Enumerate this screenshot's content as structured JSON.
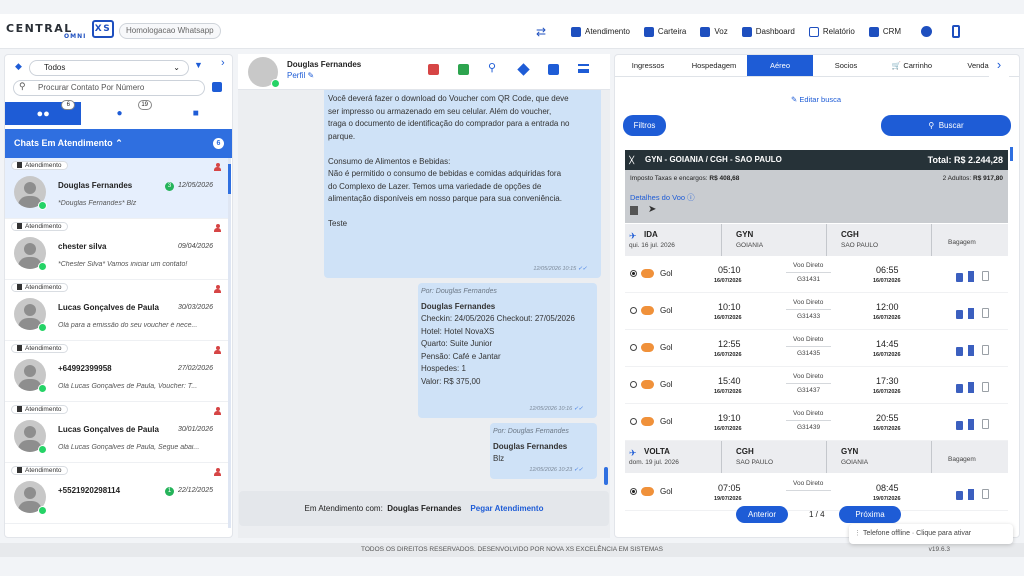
{
  "app": {
    "logo": "CENTRAL",
    "logo_sub": "OMNI",
    "logo_mark": "XS",
    "env": "Homologacao Whatsapp",
    "version": "v19.6.3",
    "footer": "TODOS OS DIREITOS RESERVADOS.  DESENVOLVIDO POR  NOVA XS EXCELÊNCIA EM SISTEMAS"
  },
  "topnav": {
    "items": [
      "Atendimento",
      "Carteira",
      "Voz",
      "Dashboard",
      "Relatório",
      "CRM"
    ]
  },
  "left": {
    "filter_value": "Todos",
    "search_placeholder": "Procurar Contato Por Número",
    "tab_badges": [
      "6",
      "19"
    ],
    "section_title": "Chats Em Atendimento",
    "section_count": "6",
    "chats": [
      {
        "tag": "Atendimento",
        "name": "Douglas Fernandes",
        "date": "12/05/2026",
        "msg": "*Douglas Fernandes* Blz",
        "unread": "3"
      },
      {
        "tag": "Atendimento",
        "name": "chester silva",
        "date": "09/04/2026",
        "msg": "*Chester Silva* Vamos iniciar um contato!",
        "unread": ""
      },
      {
        "tag": "Atendimento",
        "name": "Lucas Gonçalves de Paula",
        "date": "30/03/2026",
        "msg": "Olá para a emissão do seu voucher é nece...",
        "unread": ""
      },
      {
        "tag": "Atendimento",
        "name": "+64992399958",
        "date": "27/02/2026",
        "msg": "Olá Lucas Gonçalves de Paula, Voucher: T...",
        "unread": ""
      },
      {
        "tag": "Atendimento",
        "name": "Lucas Gonçalves de Paula",
        "date": "30/01/2026",
        "msg": "Olá Lucas Gonçalves de Paula, Segue abai...",
        "unread": ""
      },
      {
        "tag": "Atendimento",
        "name": "+5521920298114",
        "date": "22/12/2025",
        "msg": "",
        "unread": "1"
      }
    ]
  },
  "mid": {
    "contact_name": "Douglas Fernandes",
    "perfil": "Perfil",
    "msg1": {
      "lines": [
        "Você deverá fazer o download do Voucher com QR Code, que deve",
        "ser impresso ou armazenado em seu celular. Além do voucher,",
        "traga o documento de identificação do comprador para a entrada no",
        "parque.",
        "",
        "Consumo de Alimentos e Bebidas:",
        "Não é permitido o consumo de bebidas e comidas adquiridas fora",
        "do Complexo de Lazer. Temos uma variedade de opções de",
        "alimentação disponíveis em nosso parque para sua conveniência.",
        "",
        "Teste"
      ],
      "time": "12/05/2026 10:15"
    },
    "msg2": {
      "by": "Por: Douglas Fernandes",
      "title": "Douglas Fernandes",
      "lines": [
        "Checkin: 24/05/2026 Checkout: 27/05/2026",
        "Hotel: Hotel NovaXS",
        "Quarto: Suite Junior",
        "Pensão: Café e Jantar",
        "Hospedes: 1",
        "Valor: R$ 375,00"
      ],
      "time": "12/05/2026 10:16"
    },
    "msg3": {
      "by": "Por: Douglas Fernandes",
      "title": "Douglas Fernandes",
      "text": "Blz",
      "time": "12/05/2026 10:23"
    },
    "footer_label": "Em Atendimento com:",
    "footer_name": "Douglas Fernandes",
    "footer_action": "Pegar Atendimento"
  },
  "right": {
    "tabs": [
      "Ingressos",
      "Hospedagem",
      "Aéreo",
      "Socios",
      "Carrinho",
      "Venda"
    ],
    "edit": "Editar busca",
    "filtros": "Filtros",
    "buscar": "Buscar",
    "route": "GYN - GOIANIA  /  CGH - SAO PAULO",
    "total": "Total: R$ 2.244,28",
    "taxes_label": "Imposto Taxas e encargos:",
    "taxes": "R$ 408,68",
    "adults_label": "2 Adultos:",
    "adults": "R$ 917,80",
    "details": "Detalhes do Voo",
    "ida": {
      "label": "IDA",
      "date": "qui. 16 jul. 2026",
      "from": "GYN",
      "from_city": "GOIANIA",
      "to": "CGH",
      "to_city": "SAO PAULO",
      "bag": "Bagagem"
    },
    "volta": {
      "label": "VOLTA",
      "date": "dom. 19 jul. 2026",
      "from": "CGH",
      "from_city": "SAO PAULO",
      "to": "GYN",
      "to_city": "GOIANIA",
      "bag": "Bagagem"
    },
    "flights": [
      {
        "airline": "Gol",
        "dep": "05:10",
        "dep_date": "16/07/2026",
        "type": "Voo Direto",
        "code": "G31431",
        "arr": "06:55",
        "arr_date": "16/07/2026"
      },
      {
        "airline": "Gol",
        "dep": "10:10",
        "dep_date": "16/07/2026",
        "type": "Voo Direto",
        "code": "G31433",
        "arr": "12:00",
        "arr_date": "16/07/2026"
      },
      {
        "airline": "Gol",
        "dep": "12:55",
        "dep_date": "16/07/2026",
        "type": "Voo Direto",
        "code": "G31435",
        "arr": "14:45",
        "arr_date": "16/07/2026"
      },
      {
        "airline": "Gol",
        "dep": "15:40",
        "dep_date": "16/07/2026",
        "type": "Voo Direto",
        "code": "G31437",
        "arr": "17:30",
        "arr_date": "16/07/2026"
      },
      {
        "airline": "Gol",
        "dep": "19:10",
        "dep_date": "16/07/2026",
        "type": "Voo Direto",
        "code": "G31439",
        "arr": "20:55",
        "arr_date": "16/07/2026"
      }
    ],
    "return_flight": {
      "airline": "Gol",
      "dep": "07:05",
      "dep_date": "19/07/2026",
      "type": "Voo Direto",
      "code": "",
      "arr": "08:45",
      "arr_date": "19/07/2026"
    },
    "prev": "Anterior",
    "page": "1 / 4",
    "next": "Próxima"
  },
  "offline": "Telefone offline · Clique para ativar"
}
